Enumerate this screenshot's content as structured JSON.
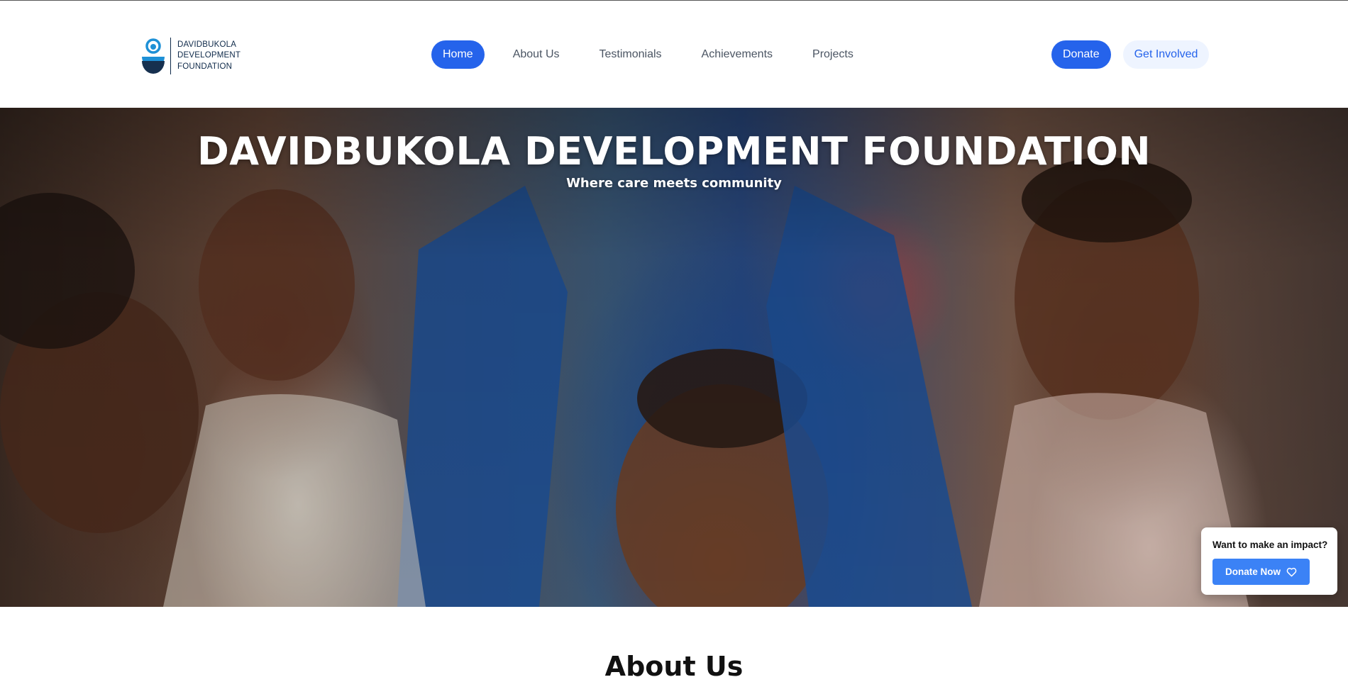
{
  "brand": {
    "line1": "DAVIDBUKOLA",
    "line2": "DEVELOPMENT",
    "line3": "FOUNDATION",
    "logo_icon": "foundation-logo-icon"
  },
  "nav": {
    "items": [
      {
        "label": "Home",
        "active": true
      },
      {
        "label": "About Us",
        "active": false
      },
      {
        "label": "Testimonials",
        "active": false
      },
      {
        "label": "Achievements",
        "active": false
      },
      {
        "label": "Projects",
        "active": false
      }
    ]
  },
  "actions": {
    "donate_label": "Donate",
    "get_involved_label": "Get Involved"
  },
  "hero": {
    "title": "DAVIDBUKOLA DEVELOPMENT FOUNDATION",
    "subtitle": "Where care meets community"
  },
  "cta": {
    "prompt": "Want to make an impact?",
    "button_label": "Donate Now",
    "button_icon": "heart-icon"
  },
  "next_section": {
    "heading": "About Us"
  },
  "colors": {
    "primary": "#2563eb",
    "cta_button": "#3b82f6",
    "brand_navy": "#0f2a4a",
    "logo_blue": "#1e90d6"
  }
}
